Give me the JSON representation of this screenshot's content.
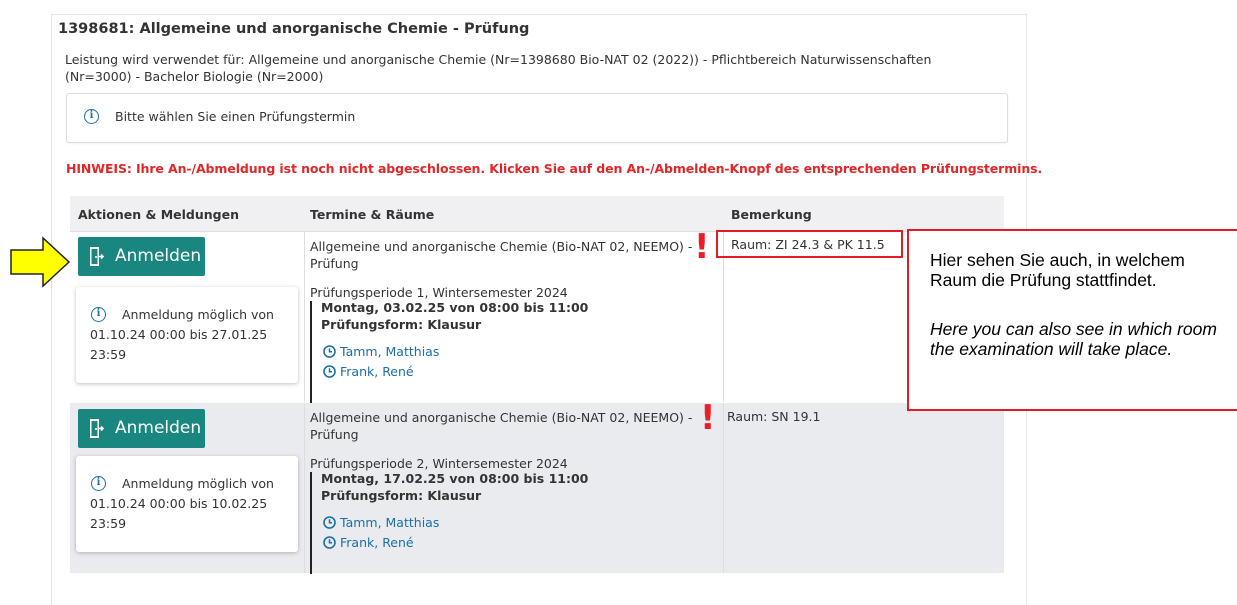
{
  "exam": {
    "title": "1398681: Allgemeine und anorganische Chemie - Prüfung",
    "usage": "Leistung wird verwendet für: Allgemeine und anorganische Chemie (Nr=1398680 Bio-NAT 02 (2022)) - Pflichtbereich Naturwissenschaften (Nr=3000) - Bachelor Biologie (Nr=2000)"
  },
  "info": {
    "icon": "info-icon",
    "message": "Bitte wählen Sie einen Prüfungstermin"
  },
  "hinweis": "HINWEIS: Ihre An-/Abmeldung ist noch nicht abgeschlossen. Klicken Sie auf den An-/Abmelden-Knopf des entsprechenden Prüfungstermins.",
  "table": {
    "headers": [
      "Aktionen & Meldungen",
      "Termine & Räume",
      "Bemerkung"
    ],
    "rows": [
      {
        "button_label": "Anmelden",
        "registration_info": "Anmeldung möglich von 01.10.24 00:00 bis 27.01.25 23:59",
        "exam_name": "Allgemeine und anorganische Chemie (Bio-NAT 02, NEEMO) - Prüfung",
        "period": "Prüfungsperiode 1, Wintersemester 2024",
        "date": "Montag, 03.02.25 von 08:00 bis 11:00",
        "form": "Prüfungsform: Klausur",
        "examiners": [
          "Tamm, Matthias",
          "Frank, René"
        ],
        "room": "Raum: ZI 24.3 & PK 11.5"
      },
      {
        "button_label": "Anmelden",
        "registration_info": "Anmeldung möglich von 01.10.24 00:00 bis 10.02.25 23:59",
        "exam_name": "Allgemeine und anorganische Chemie (Bio-NAT 02, NEEMO) - Prüfung",
        "period": "Prüfungsperiode 2, Wintersemester 2024",
        "date": "Montag, 17.02.25 von 08:00 bis 11:00",
        "form": "Prüfungsform: Klausur",
        "examiners": [
          "Tamm, Matthias",
          "Frank, René"
        ],
        "room": "Raum: SN 19.1"
      }
    ]
  },
  "annotation": {
    "exclamation": "!",
    "callout_de": "Hier sehen Sie auch, in welchem Raum die Prüfung stattfindet.",
    "callout_en": "Here you can also see in which room the examination will take place.",
    "arrow_color": "#ffff00",
    "highlight_color": "#e31b23"
  },
  "colors": {
    "button": "#198780",
    "warning": "#e0282a",
    "link": "#1b6ea8"
  }
}
